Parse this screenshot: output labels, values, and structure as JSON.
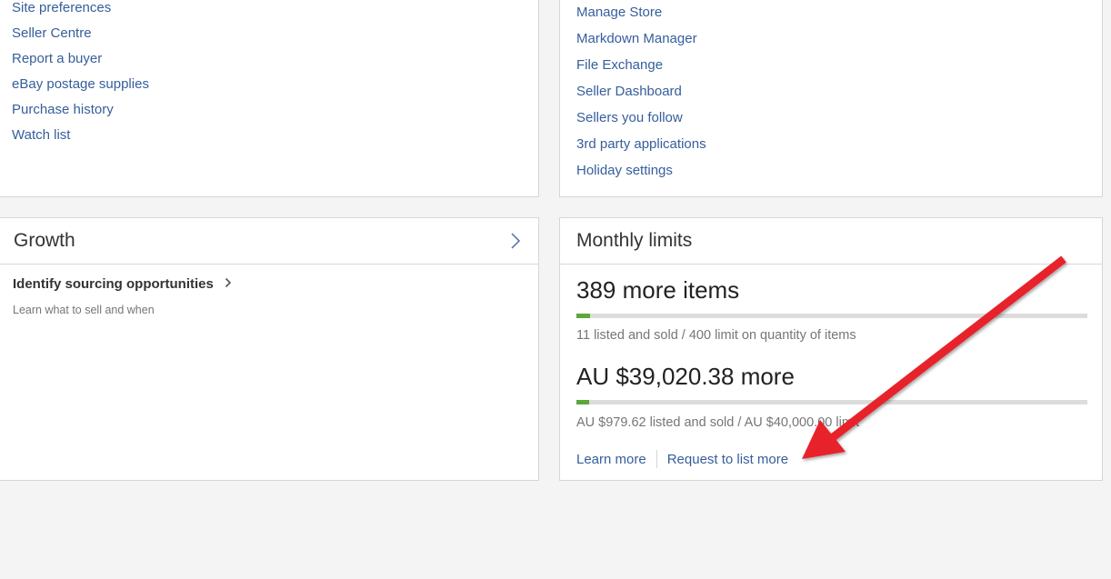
{
  "account_links": {
    "items": [
      {
        "label": "Site preferences"
      },
      {
        "label": "Seller Centre"
      },
      {
        "label": "Report a buyer"
      },
      {
        "label": "eBay postage supplies"
      },
      {
        "label": "Purchase history"
      },
      {
        "label": "Watch list"
      }
    ]
  },
  "seller_tools": {
    "items": [
      {
        "label": "Manage Store"
      },
      {
        "label": "Markdown Manager"
      },
      {
        "label": "File Exchange"
      },
      {
        "label": "Seller Dashboard"
      },
      {
        "label": "Sellers you follow"
      },
      {
        "label": "3rd party applications"
      },
      {
        "label": "Holiday settings"
      }
    ]
  },
  "growth": {
    "title": "Growth",
    "header_icon": "chevron-right-icon",
    "item_title": "Identify sourcing opportunities",
    "item_icon": "chevron-right-icon",
    "item_desc": "Learn what to sell and when"
  },
  "monthly_limits": {
    "title": "Monthly limits",
    "items_limit": {
      "headline": "389 more items",
      "used": 11,
      "limit": 400,
      "progress_fraction": 0.0275,
      "note": "11 listed and sold /  400 limit on quantity of items"
    },
    "value_limit": {
      "headline": "AU $39,020.38 more",
      "used": "AU $979.62",
      "limit": "AU $40,000.00",
      "progress_fraction": 0.0245,
      "note": "AU $979.62 listed and sold /  AU $40,000.00 limit"
    },
    "learn_more": "Learn more",
    "request_more": "Request to list more"
  },
  "annotation": {
    "arrow_color": "#e8232a"
  },
  "colors": {
    "link": "#355e9c",
    "progress": "#5ba83a",
    "track": "#dcdcdc"
  }
}
